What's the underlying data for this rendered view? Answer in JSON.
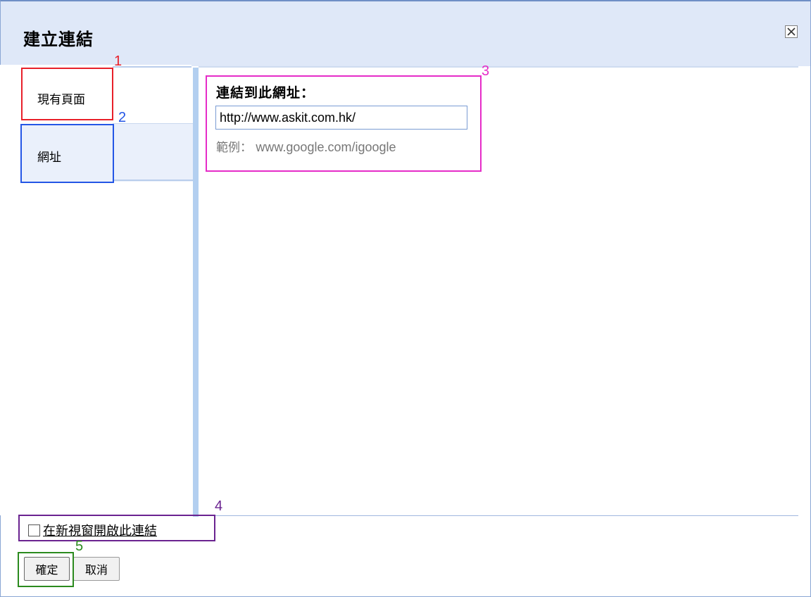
{
  "dialog": {
    "title": "建立連結"
  },
  "tabs": [
    {
      "label": "現有頁面"
    },
    {
      "label": "網址"
    }
  ],
  "content": {
    "url_label": "連結到此網址：",
    "url_value": "http://www.askit.com.hk/",
    "example_prefix": "範例：",
    "example_url": "www.google.com/igoogle"
  },
  "footer": {
    "new_window_label": "在新視窗開啟此連結",
    "new_window_checked": false,
    "ok_label": "確定",
    "cancel_label": "取消"
  },
  "annotations": [
    {
      "number": "1",
      "color": "#e8202a"
    },
    {
      "number": "2",
      "color": "#2456e6"
    },
    {
      "number": "3",
      "color": "#e62cc8"
    },
    {
      "number": "4",
      "color": "#6a2390"
    },
    {
      "number": "5",
      "color": "#2b8a1e"
    }
  ]
}
